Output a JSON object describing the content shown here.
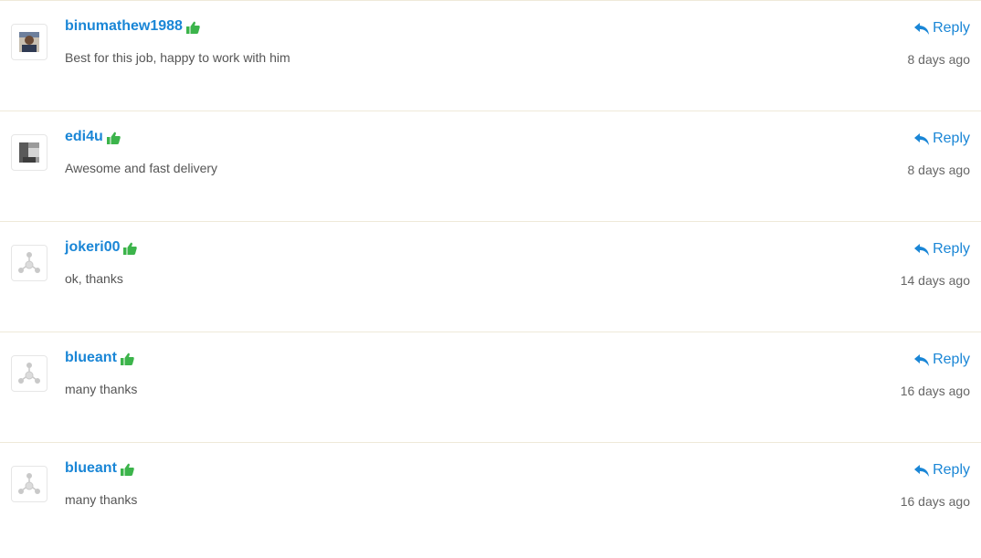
{
  "colors": {
    "link": "#1a86d6",
    "thumb": "#3cb44b",
    "divider": "#efe9d9",
    "text": "#555555"
  },
  "reviews": [
    {
      "username": "binumathew1988",
      "comment": "Best for this job, happy to work with him",
      "reply_label": "Reply",
      "time": "8 days ago",
      "avatar": "photo-avatar"
    },
    {
      "username": "edi4u",
      "comment": "Awesome and fast delivery",
      "reply_label": "Reply",
      "time": "8 days ago",
      "avatar": "photo-avatar"
    },
    {
      "username": "jokeri00",
      "comment": "ok, thanks",
      "reply_label": "Reply",
      "time": "14 days ago",
      "avatar": "default-avatar"
    },
    {
      "username": "blueant",
      "comment": "many thanks",
      "reply_label": "Reply",
      "time": "16 days ago",
      "avatar": "default-avatar"
    },
    {
      "username": "blueant",
      "comment": "many thanks",
      "reply_label": "Reply",
      "time": "16 days ago",
      "avatar": "default-avatar"
    }
  ]
}
